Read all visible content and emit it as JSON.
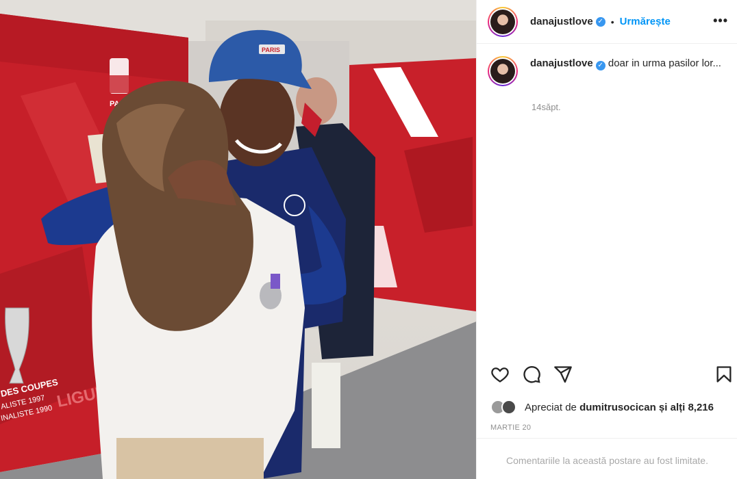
{
  "post": {
    "author": "danajustlove",
    "follow_label": "Urmărește",
    "separator": "•",
    "more_icon": "more-horizontal-icon",
    "caption": "doar in urma pasilor lor...",
    "time_ago": "14săpt.",
    "likes": {
      "prefix": "Apreciat de",
      "user": "dumitrusocican",
      "suffix": "și alți 8,216"
    },
    "date": "MARTIE 20",
    "comments_limited": "Comentariile la această postare au fost limitate.",
    "actions": [
      "heart-icon",
      "comment-icon",
      "share-icon",
      "bookmark-icon"
    ]
  },
  "photo": {
    "wall_text_1": "DES COUPES",
    "wall_text_2": "ALISTE 1997",
    "wall_text_3": "INALISTE 1990",
    "wall_text_4": "LIGUE",
    "wall_text_5": "PAR",
    "cap_text": "PARIS"
  },
  "colors": {
    "accent": "#0095f6",
    "verified": "#3897f0",
    "wall_red": "#c8202a",
    "cap_blue": "#2c5aa8"
  }
}
